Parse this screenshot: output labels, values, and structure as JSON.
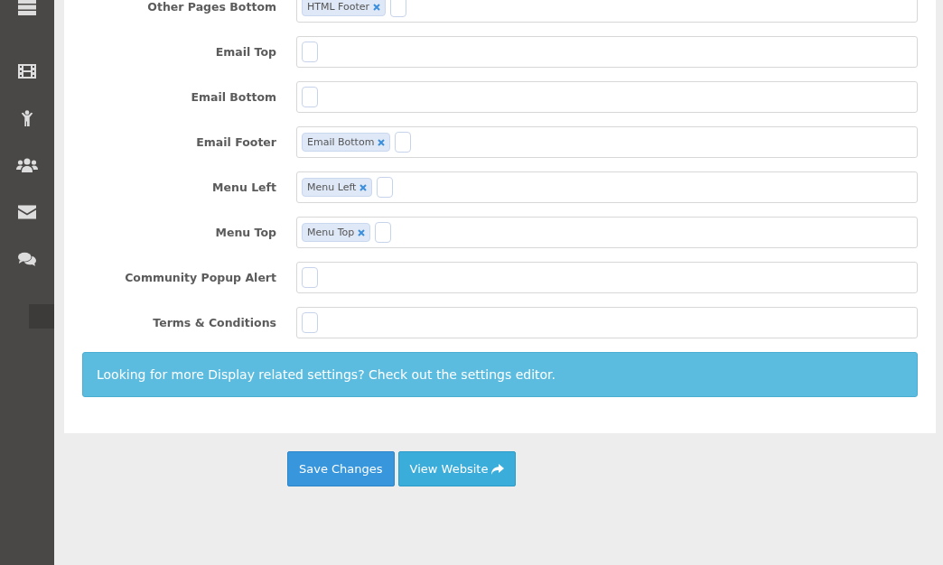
{
  "sidebar": {
    "icons": [
      {
        "kind": "list"
      },
      {
        "kind": "film"
      },
      {
        "kind": "child"
      },
      {
        "kind": "users"
      },
      {
        "kind": "envelope"
      },
      {
        "kind": "comments"
      }
    ]
  },
  "form": {
    "rows": [
      {
        "label": "Other Pages Bottom",
        "tags": [
          "HTML Footer"
        ]
      },
      {
        "label": "Email Top",
        "tags": []
      },
      {
        "label": "Email Bottom",
        "tags": []
      },
      {
        "label": "Email Footer",
        "tags": [
          "Email Bottom"
        ]
      },
      {
        "label": "Menu Left",
        "tags": [
          "Menu Left"
        ]
      },
      {
        "label": "Menu Top",
        "tags": [
          "Menu Top"
        ]
      },
      {
        "label": "Community Popup Alert",
        "tags": []
      },
      {
        "label": "Terms & Conditions",
        "tags": []
      }
    ],
    "alert": "Looking for more Display related settings? Check out the settings editor."
  },
  "buttons": {
    "save": "Save Changes",
    "view": "View Website"
  }
}
